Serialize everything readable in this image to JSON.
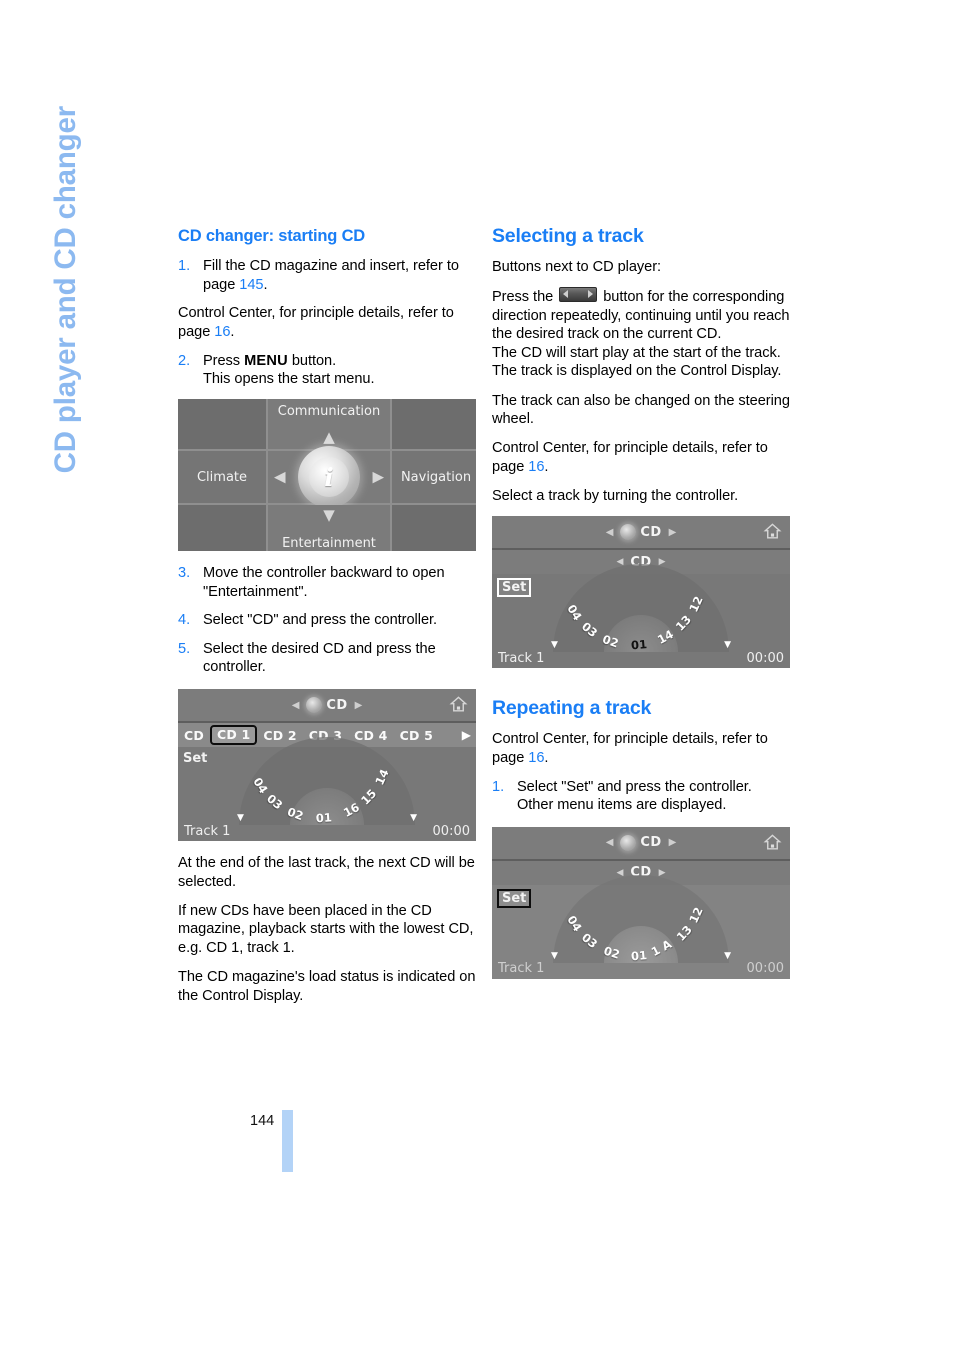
{
  "chapter_tab": "CD player and CD changer",
  "page_number": "144",
  "left_column": {
    "heading": "CD changer: starting CD",
    "step1": {
      "num": "1.",
      "text_a": "Fill the CD magazine and insert, refer to page ",
      "pageref": "145",
      "text_b": "."
    },
    "para_control_center": {
      "text_a": "Control Center, for principle details, refer to page ",
      "pageref": "16",
      "text_b": "."
    },
    "step2": {
      "num": "2.",
      "text_a": "Press ",
      "kbd": "MENU",
      "text_b": " button.",
      "line2": "This opens the start menu."
    },
    "step3": {
      "num": "3.",
      "text": "Move the controller backward to open \"Entertainment\"."
    },
    "step4": {
      "num": "4.",
      "text": "Select \"CD\" and press the controller."
    },
    "step5": {
      "num": "5.",
      "text": "Select the desired CD and press the controller."
    },
    "para_end_of_track": "At the end of the last track, the next CD will be selected.",
    "para_new_cds": "If new CDs have been placed in the CD magazine, playback starts with the lowest CD, e.g. CD 1, track 1.",
    "para_load_status": "The CD magazine's load status is indicated on the Control Display."
  },
  "right_column": {
    "heading_selecting": "Selecting a track",
    "para_buttons": "Buttons next to CD player:",
    "para_press_a": "Press the ",
    "para_press_b": " button for the corresponding direction repeatedly, continuing until you reach the desired track on the current CD.",
    "para_press_line2": "The CD will start play at the start of the track.",
    "para_press_line3": "The track is displayed on the Control Display.",
    "para_steering": "The track can also be changed on the steering wheel.",
    "para_control_center": {
      "text_a": "Control Center, for principle details, refer to page ",
      "pageref": "16",
      "text_b": "."
    },
    "para_select_turn": "Select a track by turning the controller.",
    "heading_repeating": "Repeating a track",
    "para_cc_repeat": {
      "text_a": "Control Center, for principle details, refer to page ",
      "pageref": "16",
      "text_b": "."
    },
    "step1": {
      "num": "1.",
      "text": "Select \"Set\" and press the controller.",
      "line2": "Other menu items are displayed."
    }
  },
  "screenshots": {
    "start_menu": {
      "cells": [
        "",
        "Communication",
        "",
        "Climate",
        "",
        "Navigation",
        "",
        "Entertainment",
        ""
      ],
      "center_icon": "i",
      "arrows": {
        "up": "▲",
        "down": "▼",
        "left": "◀",
        "right": "▶"
      }
    },
    "cd_select": {
      "title": "CD",
      "tabs": [
        "CD",
        "CD 1",
        "CD 2",
        "CD 3",
        "CD 4",
        "CD 5"
      ],
      "selected_tab": "CD 1",
      "more_arrow": "▶",
      "set_label": "Set",
      "track_numbers": [
        "14",
        "15",
        "16",
        "01",
        "02",
        "03",
        "04"
      ],
      "current_track": "01",
      "status_left": "Track 1",
      "status_right": "00:00"
    },
    "track_select": {
      "title": "CD",
      "subtitle": "CD",
      "set_label": "Set",
      "track_numbers": [
        "12",
        "13",
        "14",
        "01",
        "02",
        "03",
        "04"
      ],
      "current_track": "01",
      "status_left": "Track 1",
      "status_right": "00:00"
    },
    "track_set": {
      "title": "CD",
      "subtitle": "CD",
      "set_label": "Set",
      "track_numbers": [
        "12",
        "13",
        "1 A",
        "01",
        "02",
        "03",
        "04"
      ],
      "current_track": "01",
      "status_left": "Track 1",
      "status_right": "00:00"
    }
  },
  "colors": {
    "accent_blue": "#1a7ef5",
    "tab_blue": "#8cb9f0",
    "page_bar": "#b3d3f7"
  }
}
